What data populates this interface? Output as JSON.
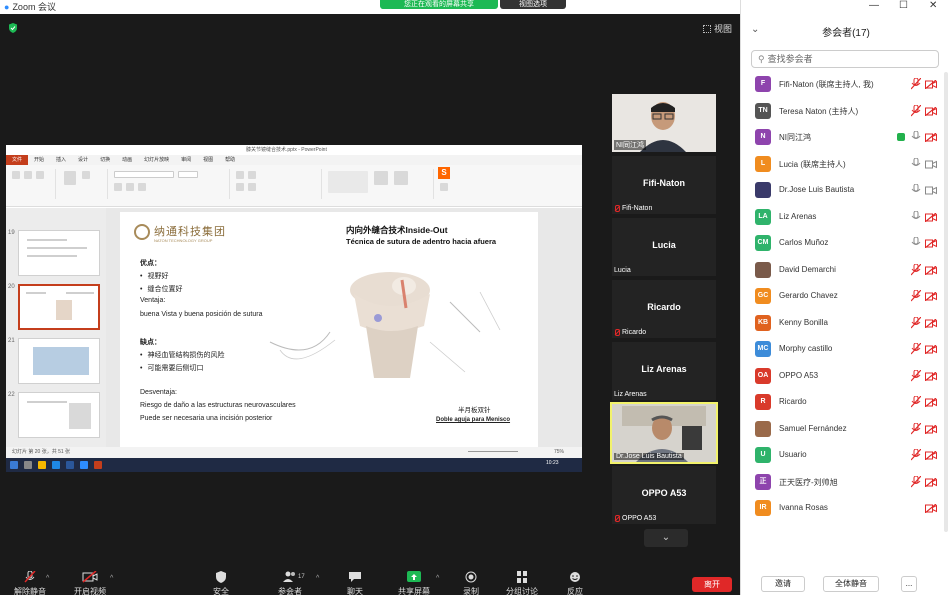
{
  "window": {
    "app_title": "Zoom 会议",
    "share_banner": "您正在观看的屏幕共享",
    "share_options": "视图选项"
  },
  "view_button": "视图",
  "shared_screen": {
    "app": "PowerPoint",
    "file_title": "膝关节镜缝合技术.pptx - PowerPoint",
    "tabs": [
      "文件",
      "开始",
      "插入",
      "设计",
      "切换",
      "动画",
      "幻灯片放映",
      "审阅",
      "视图",
      "帮助"
    ],
    "thumb_numbers": [
      "19",
      "20",
      "21",
      "22"
    ],
    "slide": {
      "logo_cn": "纳通科技集团",
      "logo_en": "NATON TECHNOLOGY GROUP",
      "title_cn": "内向外缝合技术Inside-Out",
      "title_es": "Técnica de sutura de adentro hacia afuera",
      "adv_heading": "优点：",
      "adv_items": [
        "视野好",
        "缝合位置好"
      ],
      "ventaja_heading": "Ventaja:",
      "ventaja_text": "buena Vista y buena posición de sutura",
      "disadv_heading": "缺点：",
      "disadv_items": [
        "神经血管结构损伤的风险",
        "可能需要后侧切口"
      ],
      "desventaja_heading": "Desventaja:",
      "desventaja_1": "Riesgo de daño a las estructuras neurovasculares",
      "desventaja_2": "Puede ser necesaria una incisión posterior",
      "caption_cn": "半月板双针",
      "caption_es": "Doble aguja para Menisco"
    },
    "status": "幻灯片 第 20 张，共 51 张",
    "zoom": "75%",
    "clock": "10:23"
  },
  "video_tiles": [
    {
      "name": "",
      "label": "NI同江鸿",
      "muted": false,
      "video": true
    },
    {
      "name": "Fifi-Naton",
      "label": "Fifi-Naton",
      "muted": true,
      "video": false
    },
    {
      "name": "Lucia",
      "label": "Lucia",
      "muted": false,
      "video": false
    },
    {
      "name": "Ricardo",
      "label": "Ricardo",
      "muted": true,
      "video": false
    },
    {
      "name": "Liz Arenas",
      "label": "Liz Arenas",
      "muted": false,
      "video": false
    },
    {
      "name": "",
      "label": "Dr.Jose Luis Bautista",
      "muted": false,
      "video": true
    },
    {
      "name": "OPPO A53",
      "label": "OPPO A53",
      "muted": true,
      "video": false
    }
  ],
  "more_tiles": "⌄",
  "toolbar": {
    "mute": "解除静音",
    "video": "开启视频",
    "security": "安全",
    "participants": "参会者",
    "participants_count": "17",
    "chat": "聊天",
    "share": "共享屏幕",
    "record": "录制",
    "breakout": "分组讨论",
    "reactions": "反应",
    "end": "离开"
  },
  "panel": {
    "title": "参会者(17)",
    "search_placeholder": "查找参会者",
    "invite": "邀请",
    "mute_all": "全体静音",
    "more": "...",
    "colors": {
      "purple": "#8e44ad",
      "gray": "#6e6e6e",
      "orange": "#f08c1f",
      "green": "#2fb36b",
      "blue": "#3d8cd9",
      "red": "#d93a2b"
    },
    "participants": [
      {
        "initials": "F",
        "name": "Fifi-Naton (联席主持人, 我)",
        "color": "#8e44ad",
        "mic": "muted",
        "cam": "off"
      },
      {
        "initials": "TN",
        "name": "Teresa Naton (主持人)",
        "color": "#555555",
        "mic": "muted",
        "cam": "off"
      },
      {
        "initials": "N",
        "name": "NI同江鸿",
        "color": "#8e44ad",
        "mic": "on",
        "cam": "off",
        "speaking": true
      },
      {
        "initials": "L",
        "name": "Lucia (联席主持人)",
        "color": "#f08c1f",
        "mic": "on",
        "cam": "on"
      },
      {
        "initials": "",
        "name": "Dr.Jose Luis Bautista",
        "color": "#3a3a6a",
        "mic": "on",
        "cam": "on",
        "photo": true
      },
      {
        "initials": "LA",
        "name": "Liz Arenas",
        "color": "#2fb36b",
        "mic": "on",
        "cam": "off"
      },
      {
        "initials": "CM",
        "name": "Carlos Muñoz",
        "color": "#2fb36b",
        "mic": "on",
        "cam": "off"
      },
      {
        "initials": "",
        "name": "David Demarchi",
        "color": "#7a5a4a",
        "mic": "muted",
        "cam": "off",
        "photo": true
      },
      {
        "initials": "GC",
        "name": "Gerardo Chavez",
        "color": "#f08c1f",
        "mic": "muted",
        "cam": "off"
      },
      {
        "initials": "KB",
        "name": "Kenny Bonilla",
        "color": "#e0621f",
        "mic": "muted",
        "cam": "off"
      },
      {
        "initials": "MC",
        "name": "Morphy castillo",
        "color": "#3d8cd9",
        "mic": "muted",
        "cam": "off"
      },
      {
        "initials": "OA",
        "name": "OPPO A53",
        "color": "#d93a2b",
        "mic": "muted",
        "cam": "off"
      },
      {
        "initials": "R",
        "name": "Ricardo",
        "color": "#d93a2b",
        "mic": "muted",
        "cam": "off"
      },
      {
        "initials": "",
        "name": "Samuel Fernández",
        "color": "#9a6a4a",
        "mic": "muted",
        "cam": "off",
        "photo": true
      },
      {
        "initials": "U",
        "name": "Usuario",
        "color": "#2fb36b",
        "mic": "muted",
        "cam": "off"
      },
      {
        "initials": "正",
        "name": "正天医疗-刘帅旭",
        "color": "#8e44ad",
        "mic": "muted",
        "cam": "off"
      },
      {
        "initials": "IR",
        "name": "Ivanna Rosas",
        "color": "#f08c1f",
        "mic": "none",
        "cam": "off"
      }
    ]
  }
}
